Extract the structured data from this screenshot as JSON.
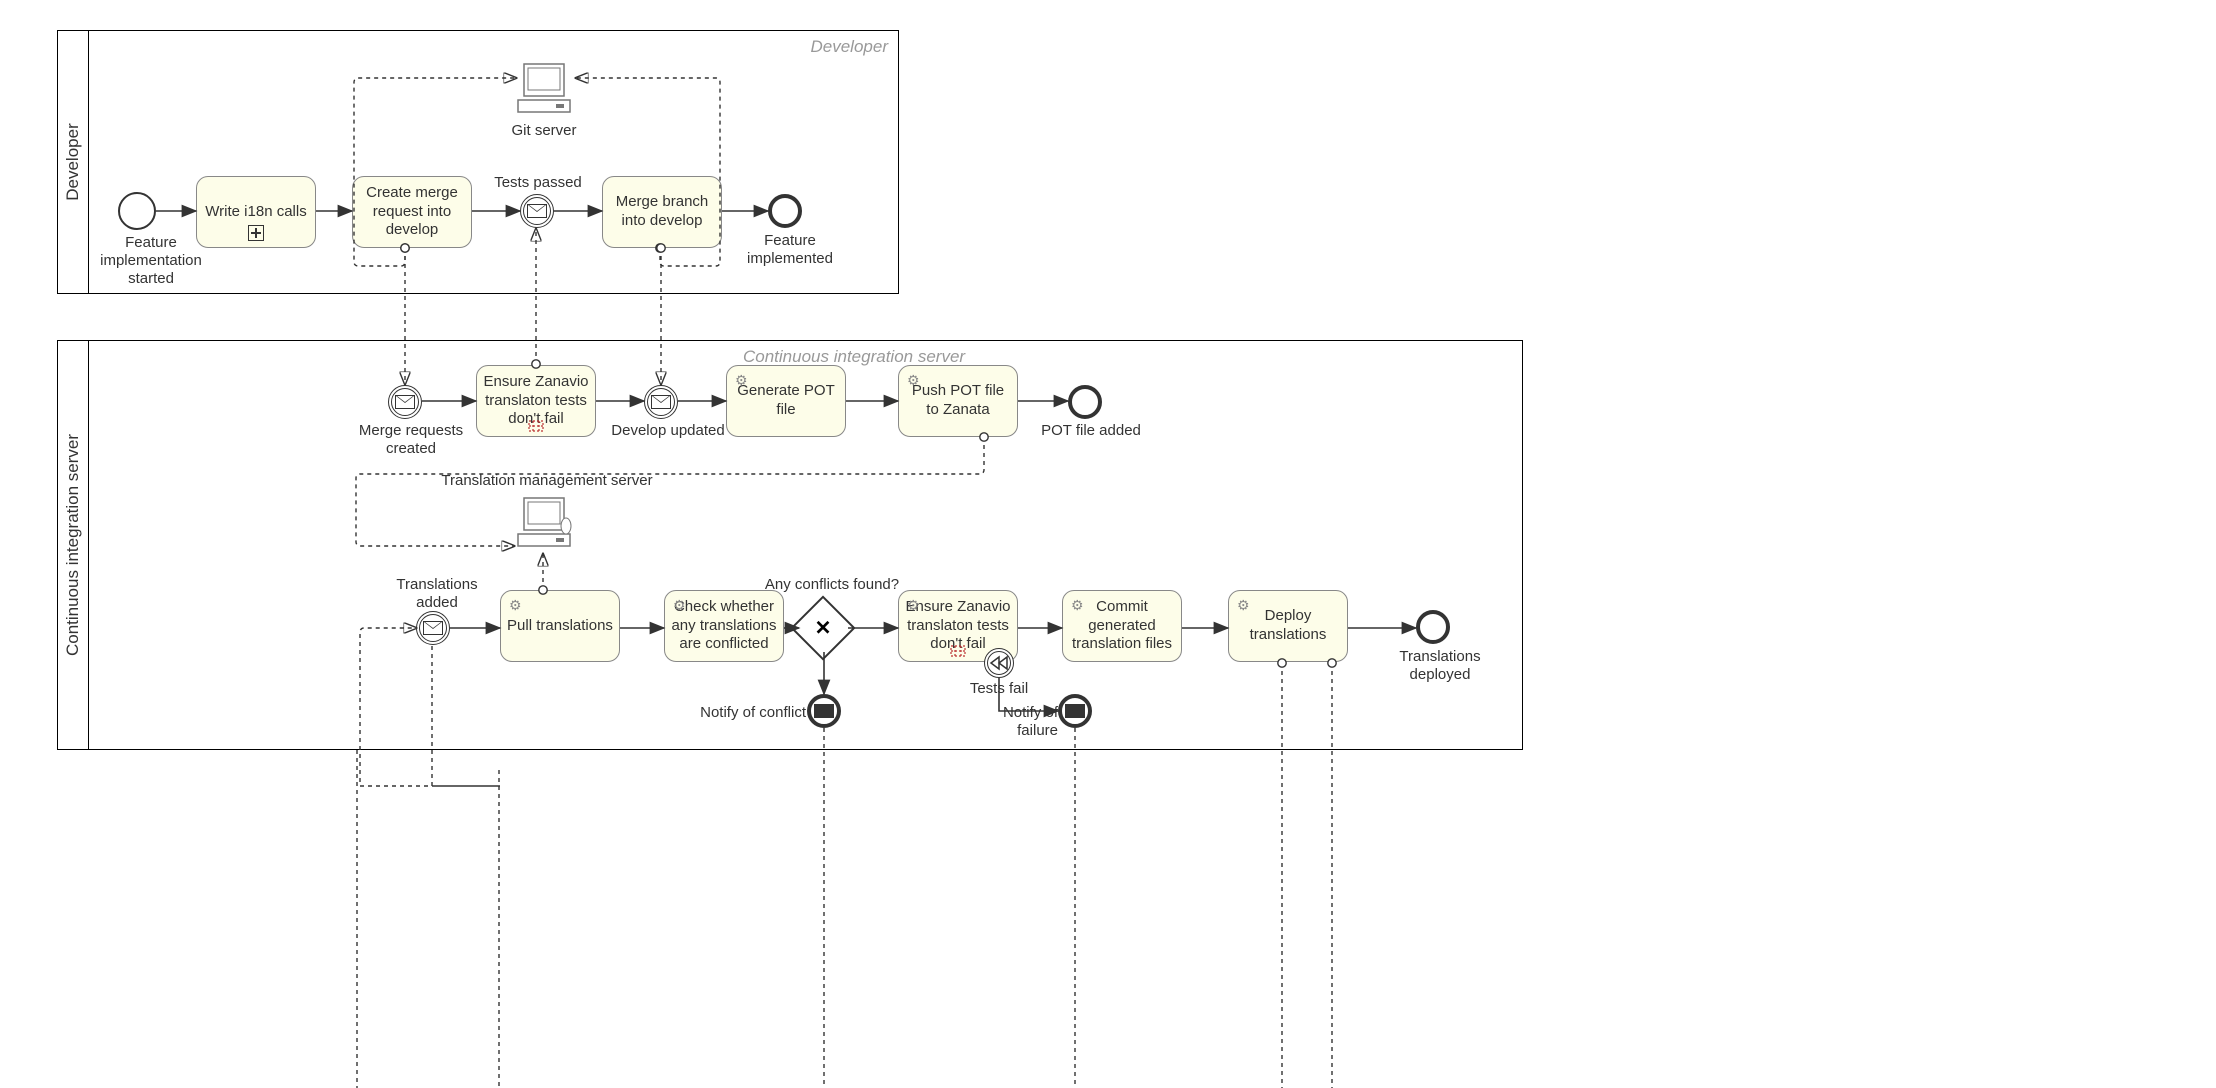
{
  "pools": {
    "developer": {
      "title": "Developer",
      "lane_title": "Developer"
    },
    "ci": {
      "title": "Continuous integration server",
      "lane_title": "Continuous integration server"
    }
  },
  "datastores": {
    "git_server": "Git server",
    "tms": "Translation management server"
  },
  "events": {
    "start_feature": "Feature implementation started",
    "tests_passed": "Tests passed",
    "feature_implemented": "Feature implemented",
    "mr_created": "Merge requests created",
    "develop_updated": "Develop updated",
    "pot_added": "POT file added",
    "translations_added": "Translations added",
    "notify_conflict": "Notify of conflict",
    "tests_fail": "Tests fail",
    "notify_failure": "Notify of failure",
    "translations_deployed": "Translations deployed"
  },
  "tasks": {
    "write_i18n": "Write i18n calls",
    "create_mr": "Create merge request into develop",
    "merge_branch": "Merge branch into develop",
    "ensure_zanavio1": "Ensure Zanavio translaton tests don't fail",
    "gen_pot": "Generate POT file",
    "push_pot": "Push POT file to Zanata",
    "pull_trans": "Pull translations",
    "check_conflict": "Check whether any translations are conflicted",
    "ensure_zanavio2": "Ensure Zanavio translaton tests don't fail",
    "commit_files": "Commit generated translation files",
    "deploy_trans": "Deploy translations"
  },
  "gateways": {
    "any_conflicts": "Any conflicts found?"
  }
}
